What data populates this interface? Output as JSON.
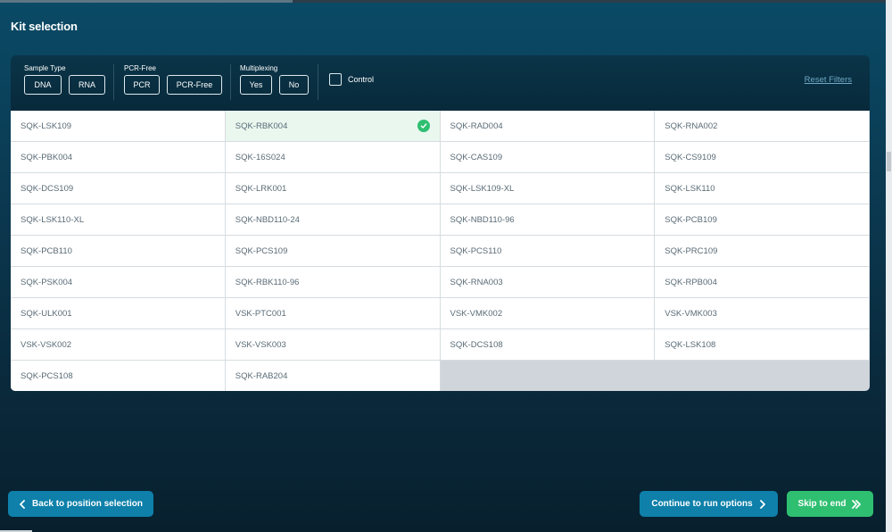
{
  "title": "Kit selection",
  "filters": {
    "sample_type": {
      "label": "Sample Type",
      "options": [
        "DNA",
        "RNA"
      ]
    },
    "pcr_free": {
      "label": "PCR-Free",
      "options": [
        "PCR",
        "PCR-Free"
      ]
    },
    "multiplexing": {
      "label": "Multiplexing",
      "options": [
        "Yes",
        "No"
      ]
    },
    "control_label": "Control",
    "reset_label": "Reset Filters"
  },
  "kits": [
    "SQK-LSK109",
    "SQK-RBK004",
    "SQK-RAD004",
    "SQK-RNA002",
    "SQK-PBK004",
    "SQK-16S024",
    "SQK-CAS109",
    "SQK-CS9109",
    "SQK-DCS109",
    "SQK-LRK001",
    "SQK-LSK109-XL",
    "SQK-LSK110",
    "SQK-LSK110-XL",
    "SQK-NBD110-24",
    "SQK-NBD110-96",
    "SQK-PCB109",
    "SQK-PCB110",
    "SQK-PCS109",
    "SQK-PCS110",
    "SQK-PRC109",
    "SQK-PSK004",
    "SQK-RBK110-96",
    "SQK-RNA003",
    "SQK-RPB004",
    "SQK-ULK001",
    "VSK-PTC001",
    "VSK-VMK002",
    "VSK-VMK003",
    "VSK-VSK002",
    "VSK-VSK003",
    "SQK-DCS108",
    "SQK-LSK108",
    "SQK-PCS108",
    "SQK-RAB204"
  ],
  "selected_kit": "SQK-RBK004",
  "buttons": {
    "back": "Back to position selection",
    "continue": "Continue to run options",
    "skip": "Skip to end"
  },
  "colors": {
    "accent_blue": "#0e80aa",
    "accent_green": "#2fbf71",
    "selected_bg": "#e9f7ef"
  }
}
